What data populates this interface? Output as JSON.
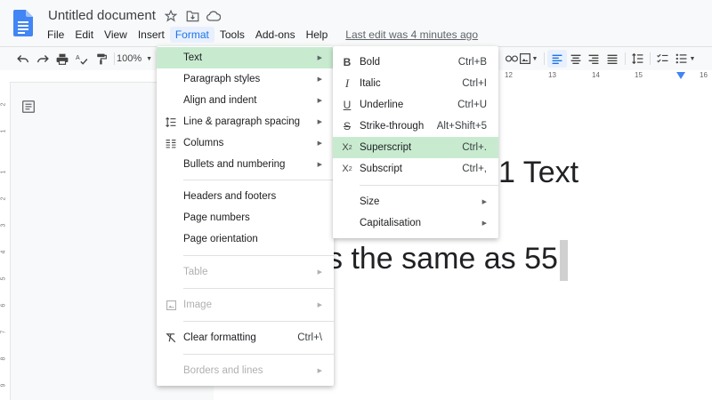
{
  "header": {
    "doc_title": "Untitled document",
    "last_edit": "Last edit was 4 minutes ago",
    "icons": [
      "star-icon",
      "move-to-folder-icon",
      "cloud-status-icon"
    ]
  },
  "menubar": {
    "items": [
      "File",
      "Edit",
      "View",
      "Insert",
      "Format",
      "Tools",
      "Add-ons",
      "Help"
    ],
    "active": "Format"
  },
  "toolbar": {
    "zoom": "100%",
    "ruler_numbers": [
      "12",
      "13",
      "14",
      "15",
      "16"
    ]
  },
  "vruler": {
    "numbers": [
      "2",
      "1",
      "1",
      "2",
      "3",
      "4",
      "5",
      "6",
      "7",
      "8",
      "9"
    ]
  },
  "document": {
    "line1": "1 Text",
    "line2": "s the same as 55"
  },
  "format_menu": {
    "items": [
      {
        "label": "Text",
        "icon": "",
        "submenu": true,
        "highlighted": true
      },
      {
        "label": "Paragraph styles",
        "icon": "",
        "submenu": true
      },
      {
        "label": "Align and indent",
        "icon": "",
        "submenu": true
      },
      {
        "label": "Line & paragraph spacing",
        "icon": "line-spacing-icon",
        "submenu": true
      },
      {
        "label": "Columns",
        "icon": "columns-icon",
        "submenu": true
      },
      {
        "label": "Bullets and numbering",
        "icon": "",
        "submenu": true
      },
      {
        "label": "Headers and footers"
      },
      {
        "label": "Page numbers"
      },
      {
        "label": "Page orientation"
      },
      {
        "label": "Table",
        "submenu": true,
        "disabled": true
      },
      {
        "label": "Image",
        "icon": "image-icon",
        "submenu": true,
        "disabled": true
      },
      {
        "label": "Clear formatting",
        "icon": "clear-formatting-icon",
        "shortcut": "Ctrl+\\"
      },
      {
        "label": "Borders and lines",
        "submenu": true,
        "disabled": true
      }
    ]
  },
  "text_submenu": {
    "items": [
      {
        "label": "Bold",
        "icon": "bold-icon",
        "shortcut": "Ctrl+B"
      },
      {
        "label": "Italic",
        "icon": "italic-icon",
        "shortcut": "Ctrl+I"
      },
      {
        "label": "Underline",
        "icon": "underline-icon",
        "shortcut": "Ctrl+U"
      },
      {
        "label": "Strike-through",
        "icon": "strikethrough-icon",
        "shortcut": "Alt+Shift+5"
      },
      {
        "label": "Superscript",
        "icon": "superscript-icon",
        "shortcut": "Ctrl+.",
        "highlighted": true
      },
      {
        "label": "Subscript",
        "icon": "subscript-icon",
        "shortcut": "Ctrl+,"
      },
      {
        "label": "Size",
        "submenu": true
      },
      {
        "label": "Capitalisation",
        "submenu": true
      }
    ]
  },
  "colors": {
    "accent": "#1a73e8",
    "highlight": "#c8ebd0",
    "doc_icon": "#4285f4"
  }
}
